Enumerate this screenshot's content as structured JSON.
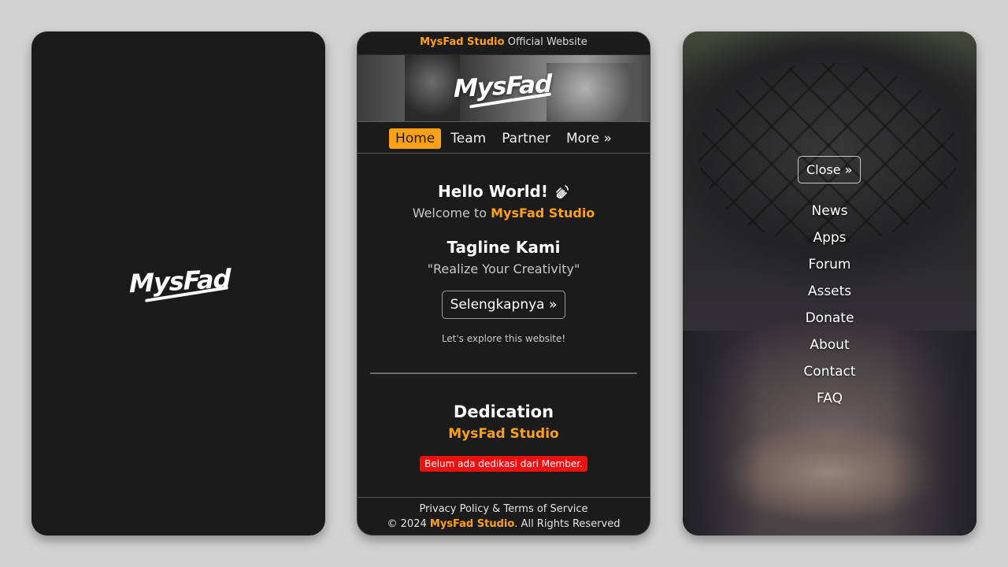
{
  "splash": {
    "logo_text": "MysFad"
  },
  "site": {
    "top_bar": {
      "brand": "MysFad Studio",
      "suffix": " Official Website"
    },
    "banner_logo": "MysFad",
    "nav": {
      "items": [
        {
          "label": "Home",
          "active": true
        },
        {
          "label": "Team",
          "active": false
        },
        {
          "label": "Partner",
          "active": false
        },
        {
          "label": "More »",
          "active": false
        }
      ]
    },
    "hero": {
      "greeting": "Hello World!",
      "greeting_icon": "waving-hand-icon",
      "welcome_prefix": "Welcome to ",
      "welcome_brand": "MysFad Studio",
      "tagline_heading": "Tagline Kami",
      "tagline": "\"Realize Your Creativity\"",
      "more_button": "Selengkapnya »",
      "explore_text": "Let's explore this website!"
    },
    "dedication": {
      "heading": "Dedication",
      "studio": "MysFad Studio",
      "empty_notice": "Belum ada dedikasi dari Member."
    },
    "footer": {
      "policy_link": "Privacy Policy & Terms of Service",
      "copyright_prefix": "© 2024 ",
      "copyright_brand": "MysFad Studio",
      "copyright_suffix": ". All Rights Reserved"
    }
  },
  "menu": {
    "close_button": "Close »",
    "items": [
      "News",
      "Apps",
      "Forum",
      "Assets",
      "Donate",
      "About",
      "Contact",
      "FAQ"
    ]
  },
  "colors": {
    "accent": "#ffa114",
    "background": "#1c1b1b",
    "alert": "#f00f0f"
  }
}
